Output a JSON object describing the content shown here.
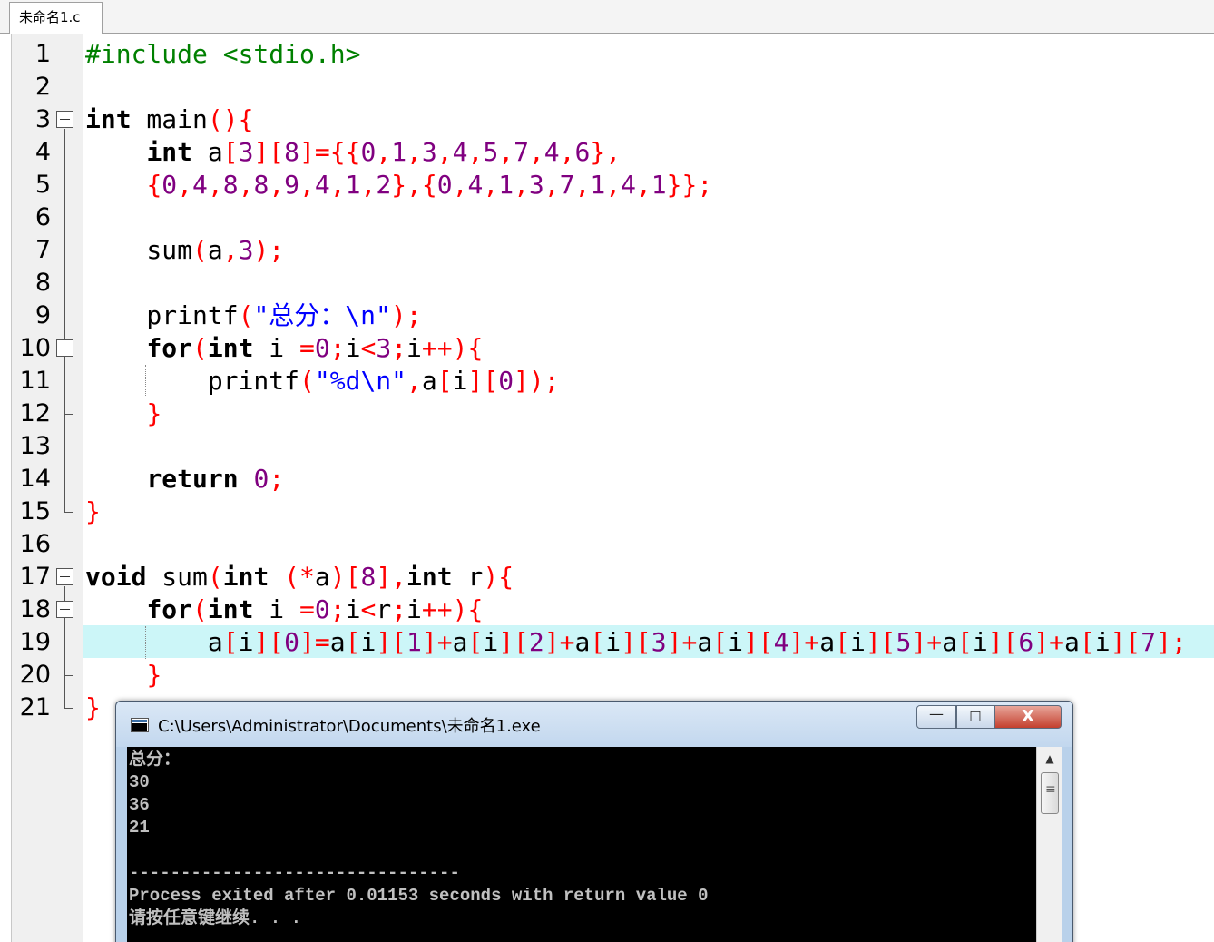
{
  "tab": {
    "label": "未命名1.c"
  },
  "gutter": {
    "line_numbers": [
      "1",
      "2",
      "3",
      "4",
      "5",
      "6",
      "7",
      "8",
      "9",
      "10",
      "11",
      "12",
      "13",
      "14",
      "15",
      "16",
      "17",
      "18",
      "19",
      "20",
      "21"
    ]
  },
  "code": {
    "highlighted_line": 19,
    "lines": [
      [
        [
          "pp",
          "#include <stdio.h>"
        ]
      ],
      [],
      [
        [
          "kw",
          "int"
        ],
        [
          "id",
          " main"
        ],
        [
          "op",
          "(){"
        ]
      ],
      [
        [
          "id",
          "    "
        ],
        [
          "kw",
          "int"
        ],
        [
          "id",
          " a"
        ],
        [
          "op",
          "["
        ],
        [
          "num",
          "3"
        ],
        [
          "op",
          "]["
        ],
        [
          "num",
          "8"
        ],
        [
          "op",
          "]={{"
        ],
        [
          "num",
          "0"
        ],
        [
          "op",
          ","
        ],
        [
          "num",
          "1"
        ],
        [
          "op",
          ","
        ],
        [
          "num",
          "3"
        ],
        [
          "op",
          ","
        ],
        [
          "num",
          "4"
        ],
        [
          "op",
          ","
        ],
        [
          "num",
          "5"
        ],
        [
          "op",
          ","
        ],
        [
          "num",
          "7"
        ],
        [
          "op",
          ","
        ],
        [
          "num",
          "4"
        ],
        [
          "op",
          ","
        ],
        [
          "num",
          "6"
        ],
        [
          "op",
          "},"
        ]
      ],
      [
        [
          "id",
          "    "
        ],
        [
          "op",
          "{"
        ],
        [
          "num",
          "0"
        ],
        [
          "op",
          ","
        ],
        [
          "num",
          "4"
        ],
        [
          "op",
          ","
        ],
        [
          "num",
          "8"
        ],
        [
          "op",
          ","
        ],
        [
          "num",
          "8"
        ],
        [
          "op",
          ","
        ],
        [
          "num",
          "9"
        ],
        [
          "op",
          ","
        ],
        [
          "num",
          "4"
        ],
        [
          "op",
          ","
        ],
        [
          "num",
          "1"
        ],
        [
          "op",
          ","
        ],
        [
          "num",
          "2"
        ],
        [
          "op",
          "},{"
        ],
        [
          "num",
          "0"
        ],
        [
          "op",
          ","
        ],
        [
          "num",
          "4"
        ],
        [
          "op",
          ","
        ],
        [
          "num",
          "1"
        ],
        [
          "op",
          ","
        ],
        [
          "num",
          "3"
        ],
        [
          "op",
          ","
        ],
        [
          "num",
          "7"
        ],
        [
          "op",
          ","
        ],
        [
          "num",
          "1"
        ],
        [
          "op",
          ","
        ],
        [
          "num",
          "4"
        ],
        [
          "op",
          ","
        ],
        [
          "num",
          "1"
        ],
        [
          "op",
          "}};"
        ]
      ],
      [],
      [
        [
          "id",
          "    sum"
        ],
        [
          "op",
          "("
        ],
        [
          "id",
          "a"
        ],
        [
          "op",
          ","
        ],
        [
          "num",
          "3"
        ],
        [
          "op",
          ");"
        ]
      ],
      [],
      [
        [
          "id",
          "    printf"
        ],
        [
          "op",
          "("
        ],
        [
          "str",
          "\"总分：\\n\""
        ],
        [
          "op",
          ");"
        ]
      ],
      [
        [
          "id",
          "    "
        ],
        [
          "kw",
          "for"
        ],
        [
          "op",
          "("
        ],
        [
          "kw",
          "int"
        ],
        [
          "id",
          " i "
        ],
        [
          "op",
          "="
        ],
        [
          "num",
          "0"
        ],
        [
          "op",
          ";"
        ],
        [
          "id",
          "i"
        ],
        [
          "op",
          "<"
        ],
        [
          "num",
          "3"
        ],
        [
          "op",
          ";"
        ],
        [
          "id",
          "i"
        ],
        [
          "op",
          "++){"
        ]
      ],
      [
        [
          "id",
          "        printf"
        ],
        [
          "op",
          "("
        ],
        [
          "str",
          "\"%d\\n\""
        ],
        [
          "op",
          ","
        ],
        [
          "id",
          "a"
        ],
        [
          "op",
          "["
        ],
        [
          "id",
          "i"
        ],
        [
          "op",
          "]["
        ],
        [
          "num",
          "0"
        ],
        [
          "op",
          "]);"
        ]
      ],
      [
        [
          "id",
          "    "
        ],
        [
          "op",
          "}"
        ]
      ],
      [],
      [
        [
          "id",
          "    "
        ],
        [
          "kw",
          "return"
        ],
        [
          "id",
          " "
        ],
        [
          "num",
          "0"
        ],
        [
          "op",
          ";"
        ]
      ],
      [
        [
          "op",
          "}"
        ]
      ],
      [],
      [
        [
          "kw",
          "void"
        ],
        [
          "id",
          " sum"
        ],
        [
          "op",
          "("
        ],
        [
          "kw",
          "int"
        ],
        [
          "id",
          " "
        ],
        [
          "op",
          "(*"
        ],
        [
          "id",
          "a"
        ],
        [
          "op",
          ")["
        ],
        [
          "num",
          "8"
        ],
        [
          "op",
          "],"
        ],
        [
          "kw",
          "int"
        ],
        [
          "id",
          " r"
        ],
        [
          "op",
          "){"
        ]
      ],
      [
        [
          "id",
          "    "
        ],
        [
          "kw",
          "for"
        ],
        [
          "op",
          "("
        ],
        [
          "kw",
          "int"
        ],
        [
          "id",
          " i "
        ],
        [
          "op",
          "="
        ],
        [
          "num",
          "0"
        ],
        [
          "op",
          ";"
        ],
        [
          "id",
          "i"
        ],
        [
          "op",
          "<"
        ],
        [
          "id",
          "r"
        ],
        [
          "op",
          ";"
        ],
        [
          "id",
          "i"
        ],
        [
          "op",
          "++){"
        ]
      ],
      [
        [
          "id",
          "        a"
        ],
        [
          "op",
          "["
        ],
        [
          "id",
          "i"
        ],
        [
          "op",
          "]["
        ],
        [
          "num",
          "0"
        ],
        [
          "op",
          "]="
        ],
        [
          "id",
          "a"
        ],
        [
          "op",
          "["
        ],
        [
          "id",
          "i"
        ],
        [
          "op",
          "]["
        ],
        [
          "num",
          "1"
        ],
        [
          "op",
          "]+"
        ],
        [
          "id",
          "a"
        ],
        [
          "op",
          "["
        ],
        [
          "id",
          "i"
        ],
        [
          "op",
          "]["
        ],
        [
          "num",
          "2"
        ],
        [
          "op",
          "]+"
        ],
        [
          "id",
          "a"
        ],
        [
          "op",
          "["
        ],
        [
          "id",
          "i"
        ],
        [
          "op",
          "]["
        ],
        [
          "num",
          "3"
        ],
        [
          "op",
          "]+"
        ],
        [
          "id",
          "a"
        ],
        [
          "op",
          "["
        ],
        [
          "id",
          "i"
        ],
        [
          "op",
          "]["
        ],
        [
          "num",
          "4"
        ],
        [
          "op",
          "]+"
        ],
        [
          "id",
          "a"
        ],
        [
          "op",
          "["
        ],
        [
          "id",
          "i"
        ],
        [
          "op",
          "]["
        ],
        [
          "num",
          "5"
        ],
        [
          "op",
          "]+"
        ],
        [
          "id",
          "a"
        ],
        [
          "op",
          "["
        ],
        [
          "id",
          "i"
        ],
        [
          "op",
          "]["
        ],
        [
          "num",
          "6"
        ],
        [
          "op",
          "]+"
        ],
        [
          "id",
          "a"
        ],
        [
          "op",
          "["
        ],
        [
          "id",
          "i"
        ],
        [
          "op",
          "]["
        ],
        [
          "num",
          "7"
        ],
        [
          "op",
          "];"
        ]
      ],
      [
        [
          "id",
          "    "
        ],
        [
          "op",
          "}"
        ]
      ],
      [
        [
          "op",
          "}"
        ]
      ]
    ]
  },
  "console": {
    "title": "C:\\Users\\Administrator\\Documents\\未命名1.exe",
    "buttons": {
      "minimize": "—",
      "maximize": "□",
      "close": "X"
    },
    "scroll_up": "▲",
    "output": [
      "总分：",
      "30",
      "36",
      "21",
      "",
      "--------------------------------",
      "Process exited after 0.01153 seconds with return value 0",
      "请按任意键继续. . ."
    ]
  }
}
